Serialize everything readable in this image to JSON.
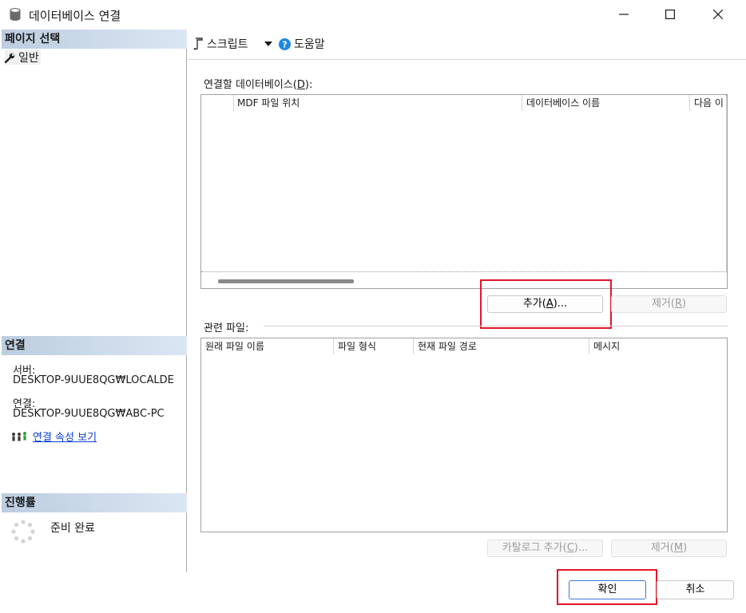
{
  "window": {
    "title": "데이터베이스 연결",
    "icon": "database-icon",
    "controls": [
      "minimize-icon",
      "maximize-icon",
      "close-icon"
    ]
  },
  "left_pane": {
    "page_select": {
      "header": "페이지 선택",
      "items": [
        {
          "label": "일반",
          "icon": "wrench-icon"
        }
      ]
    },
    "connection": {
      "header": "연결",
      "server_label": "서버:",
      "server_value": "DESKTOP-9UUE8QG₩LOCALDE",
      "connection_label": "연결:",
      "connection_value": "DESKTOP-9UUE8QG₩ABC-PC",
      "view_properties_link": "연결 속성 보기"
    },
    "progress": {
      "header": "진행률",
      "status": "준비 완료"
    }
  },
  "toolbar": {
    "script_label": "스크립트",
    "help_label": "도움말"
  },
  "databases_section": {
    "label_prefix": "연결할 데이터베이스(",
    "label_mnemonic": "D",
    "label_suffix": "):",
    "columns": [
      "MDF 파일 위치",
      "데이터베이스 이름",
      "다음 이"
    ],
    "rows": [],
    "add_button_prefix": "추가(",
    "add_button_mnemonic": "A",
    "add_button_suffix": ")...",
    "remove_button_prefix": "제거(",
    "remove_button_mnemonic": "R",
    "remove_button_suffix": ")"
  },
  "related_files_section": {
    "label": "관련 파일:",
    "columns": [
      "원래 파일 이름",
      "파일 형식",
      "현재 파일 경로",
      "메시지"
    ],
    "rows": [],
    "catalog_button_prefix": "카탈로그 추가(",
    "catalog_button_mnemonic": "C",
    "catalog_button_suffix": ")...",
    "remove_button_prefix": "제거(",
    "remove_button_mnemonic": "M",
    "remove_button_suffix": ")"
  },
  "footer": {
    "ok_label": "확인",
    "cancel_label": "취소"
  },
  "colors": {
    "highlight": "#e3142b",
    "section_header": "#c8d7e8",
    "link": "#0b3fd6",
    "help_icon": "#1e88e5"
  }
}
